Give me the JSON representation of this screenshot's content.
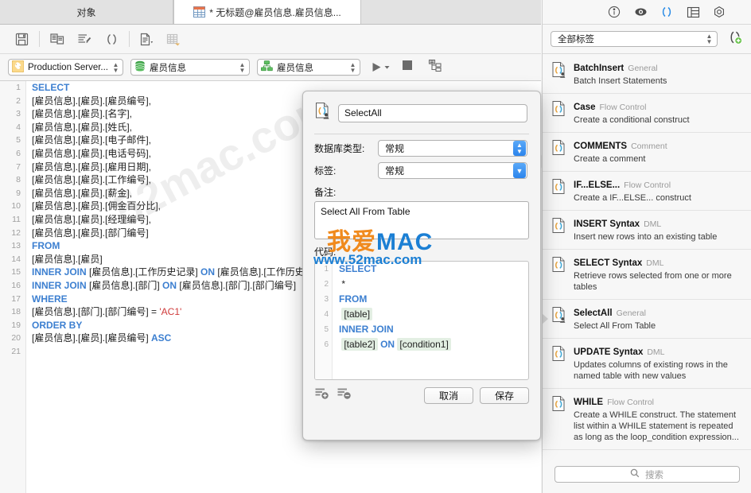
{
  "window": {
    "tabs": [
      {
        "label": "对象",
        "active": false,
        "icon": "none"
      },
      {
        "label": "* 无标题@雇员信息.雇员信息...",
        "active": true,
        "icon": "table-icon"
      }
    ]
  },
  "toolbar": {
    "buttons": [
      {
        "name": "save-button",
        "icon": "floppy-disk-icon"
      },
      {
        "name": "copy-button",
        "icon": "copy-pages-icon"
      },
      {
        "name": "edit-query-button",
        "icon": "list-pencil-icon"
      },
      {
        "name": "code-snippet-button",
        "icon": "parentheses-icon"
      },
      {
        "name": "explain-button",
        "icon": "document-dropdown-icon"
      },
      {
        "name": "export-table-button",
        "icon": "table-export-icon"
      }
    ]
  },
  "connection": {
    "server": "Production Server...",
    "database": "雇员信息",
    "schema": "雇员信息",
    "run_icon": "play-icon",
    "stop_icon": "stop-icon",
    "plan_icon": "explain-plan-icon"
  },
  "editor": {
    "lines": [
      {
        "n": 1,
        "html": "<span class=\"kw\">SELECT</span>"
      },
      {
        "n": 2,
        "html": "[雇员信息].[雇员].[雇员编号],"
      },
      {
        "n": 3,
        "html": "[雇员信息].[雇员].[名字],"
      },
      {
        "n": 4,
        "html": "[雇员信息].[雇员].[姓氏],"
      },
      {
        "n": 5,
        "html": "[雇员信息].[雇员].[电子邮件],"
      },
      {
        "n": 6,
        "html": "[雇员信息].[雇员].[电话号码],"
      },
      {
        "n": 7,
        "html": "[雇员信息].[雇员].[雇用日期],"
      },
      {
        "n": 8,
        "html": "[雇员信息].[雇员].[工作编号],"
      },
      {
        "n": 9,
        "html": "[雇员信息].[雇员].[薪金],"
      },
      {
        "n": 10,
        "html": "[雇员信息].[雇员].[佣金百分比],"
      },
      {
        "n": 11,
        "html": "[雇员信息].[雇员].[经理编号],"
      },
      {
        "n": 12,
        "html": "[雇员信息].[雇员].[部门编号]"
      },
      {
        "n": 13,
        "html": "<span class=\"kw\">FROM</span>"
      },
      {
        "n": 14,
        "html": "[雇员信息].[雇员]"
      },
      {
        "n": 15,
        "html": "<span class=\"kw\">INNER JOIN</span> [雇员信息].[工作历史记录] <span class=\"kw\">ON</span> [雇员信息].[工作历史"
      },
      {
        "n": 16,
        "html": "<span class=\"kw\">INNER JOIN</span> [雇员信息].[部门] <span class=\"kw\">ON</span> [雇员信息].[部门].[部门编号]"
      },
      {
        "n": 17,
        "html": "<span class=\"kw\">WHERE</span>"
      },
      {
        "n": 18,
        "html": "[雇员信息].[部门].[部门编号] = <span class=\"str\">'AC1'</span>"
      },
      {
        "n": 19,
        "html": "<span class=\"kw\">ORDER BY</span>"
      },
      {
        "n": 20,
        "html": "[雇员信息].[雇员].[雇员编号] <span class=\"kw\">ASC</span>"
      },
      {
        "n": 21,
        "html": ""
      }
    ]
  },
  "right_panel": {
    "header_icons": [
      {
        "name": "info-icon"
      },
      {
        "name": "eye-icon"
      },
      {
        "name": "parentheses-icon"
      },
      {
        "name": "table-grid-icon"
      },
      {
        "name": "hexagon-gear-icon"
      }
    ],
    "filter_value": "全部标签",
    "add_snippet_icon": "add-snippet-icon",
    "snippets": [
      {
        "title": "BatchInsert",
        "category": "General",
        "desc": "Batch Insert Statements",
        "selected": false,
        "user": true
      },
      {
        "title": "Case",
        "category": "Flow Control",
        "desc": "Create a conditional construct",
        "selected": false,
        "user": false
      },
      {
        "title": "COMMENTS",
        "category": "Comment",
        "desc": "Create a comment",
        "selected": false,
        "user": false
      },
      {
        "title": "IF...ELSE...",
        "category": "Flow Control",
        "desc": "Create a IF...ELSE... construct",
        "selected": false,
        "user": false
      },
      {
        "title": "INSERT Syntax",
        "category": "DML",
        "desc": "Insert new rows into an existing table",
        "selected": false,
        "user": false
      },
      {
        "title": "SELECT Syntax",
        "category": "DML",
        "desc": "Retrieve rows selected from one or more tables",
        "selected": false,
        "user": false
      },
      {
        "title": "SelectAll",
        "category": "General",
        "desc": "Select All From Table",
        "selected": true,
        "user": true
      },
      {
        "title": "UPDATE Syntax",
        "category": "DML",
        "desc": "Updates columns of existing rows in the named table with new values",
        "selected": false,
        "user": false
      },
      {
        "title": "WHILE",
        "category": "Flow Control",
        "desc": "Create a WHILE construct. The statement list within a WHILE statement is repeated as long as the loop_condition expression...",
        "selected": false,
        "user": false
      }
    ],
    "search_placeholder": "搜索",
    "search_icon": "search-icon"
  },
  "dialog": {
    "icon": "snippet-user-icon",
    "name_value": "SelectAll",
    "db_type_label": "数据库类型:",
    "db_type_value": "常规",
    "tag_label": "标签:",
    "tag_value": "常规",
    "notes_label": "备注:",
    "notes_value": "Select All From Table",
    "code_label": "代码:",
    "code_lines": [
      {
        "n": 1,
        "html": "<span class=\"kw\">SELECT</span>"
      },
      {
        "n": 2,
        "html": "&nbsp;*"
      },
      {
        "n": 3,
        "html": "<span class=\"kw\">FROM</span>"
      },
      {
        "n": 4,
        "html": "&nbsp;<span class=\"tok\">[table]</span>"
      },
      {
        "n": 5,
        "html": "<span class=\"kw\">INNER JOIN</span>"
      },
      {
        "n": 6,
        "html": "&nbsp;<span class=\"tok\">[table2]</span> <span class=\"kw\">ON</span> <span class=\"tok\">[condition1]</span>"
      }
    ],
    "add_param_icon": "add-param-icon",
    "remove_param_icon": "remove-param-icon",
    "cancel_label": "取消",
    "save_label": "保存"
  },
  "watermark": {
    "text_cn": "我爱",
    "text_en": "MAC",
    "url": "www.52mac.com",
    "diag": "52mac.com",
    "color_orange": "#f08a1d",
    "color_blue": "#1b7fd4"
  }
}
